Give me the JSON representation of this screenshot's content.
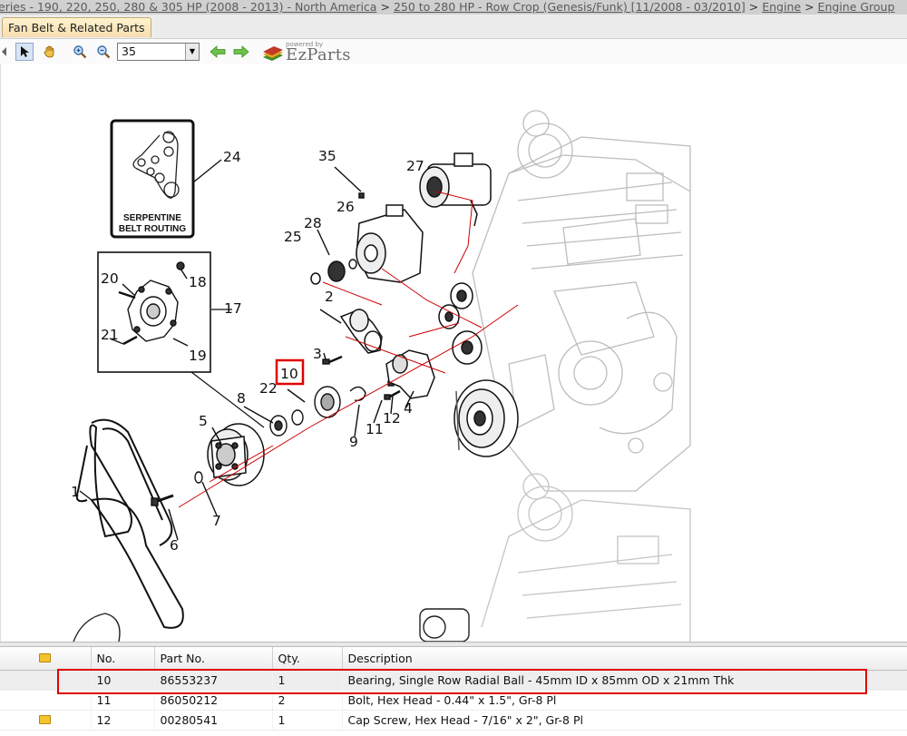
{
  "breadcrumb": {
    "items": [
      "eries - 190, 220, 250, 280 & 305 HP (2008 - 2013) - North America",
      "250 to 280 HP - Row Crop (Genesis/Funk) [11/2008 - 03/2010]",
      "Engine",
      "Engine Group"
    ],
    "separator": ">"
  },
  "tab": {
    "label": "Fan Belt & Related Parts"
  },
  "toolbar": {
    "zoom_value": "35",
    "buttons": [
      "select-arrow-icon",
      "hand-pan-icon",
      "zoom-in-icon",
      "zoom-out-icon",
      "back-arrow-icon",
      "forward-arrow-icon"
    ]
  },
  "logo": {
    "powered_by": "powered by",
    "name": "EzParts"
  },
  "diagram": {
    "inset_caption_line1": "SERPENTINE",
    "inset_caption_line2": "BELT ROUTING",
    "callouts": [
      "24",
      "35",
      "27",
      "26",
      "28",
      "25",
      "20",
      "18",
      "17",
      "2",
      "21",
      "19",
      "3",
      "10",
      "22",
      "8",
      "4",
      "11",
      "12",
      "9",
      "5",
      "1",
      "6",
      "7"
    ],
    "selected_callout": "10"
  },
  "table": {
    "headers": {
      "icon": "",
      "no": "No.",
      "part_no": "Part No.",
      "qty": "Qty.",
      "description": "Description"
    },
    "rows": [
      {
        "note": false,
        "no": "10",
        "part_no": "86553237",
        "qty": "1",
        "description": "Bearing, Single Row Radial Ball - 45mm ID x 85mm OD x 21mm Thk"
      },
      {
        "note": false,
        "no": "11",
        "part_no": "86050212",
        "qty": "2",
        "description": "Bolt, Hex Head - 0.44\" x 1.5\", Gr-8 Pl"
      },
      {
        "note": true,
        "no": "12",
        "part_no": "00280541",
        "qty": "1",
        "description": "Cap Screw, Hex Head - 7/16\" x 2\", Gr-8 Pl"
      }
    ],
    "selected_row": 0
  },
  "colors": {
    "highlight": "#e00000",
    "tab_bg": "#f6ddb0",
    "crumb_bar": "#d0d0d0"
  }
}
